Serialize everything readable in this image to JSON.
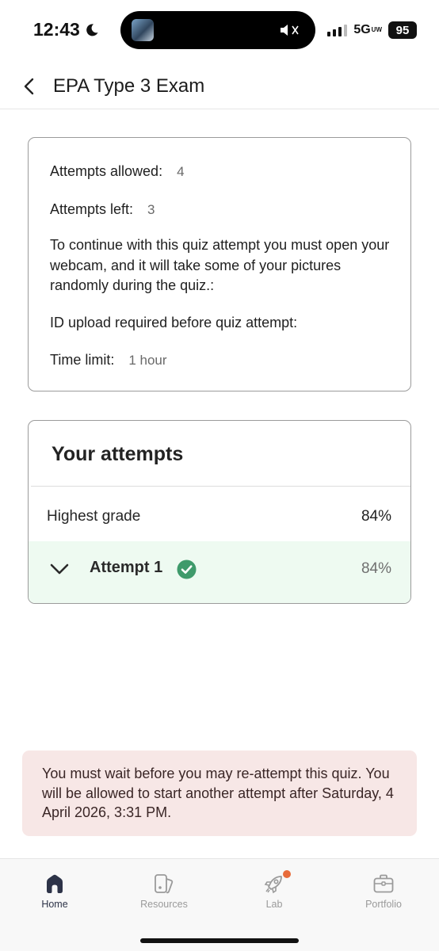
{
  "status_bar": {
    "time": "12:43",
    "network": "5G",
    "network_suffix": "UW",
    "battery": "95"
  },
  "header": {
    "title": "EPA Type 3 Exam"
  },
  "quiz_info": {
    "attempts_allowed_label": "Attempts allowed:",
    "attempts_allowed_value": "4",
    "attempts_left_label": "Attempts left:",
    "attempts_left_value": "3",
    "webcam_notice": "To continue with this quiz attempt you must open your webcam, and it will take some of your pictures randomly during the quiz.:",
    "id_upload_notice": "ID upload required before quiz attempt:",
    "time_limit_label": "Time limit:",
    "time_limit_value": "1 hour"
  },
  "attempts": {
    "title": "Your attempts",
    "highest_grade_label": "Highest grade",
    "highest_grade_value": "84%",
    "items": [
      {
        "label": "Attempt 1",
        "grade": "84%",
        "status_icon": "check-circle-icon",
        "status_color": "#3f9a6b"
      }
    ]
  },
  "notice": {
    "text": "You must wait before you may re-attempt this quiz. You will be allowed to start another attempt after Saturday, 4 April 2026, 3:31 PM."
  },
  "bottom_nav": {
    "items": [
      {
        "label": "Home",
        "icon": "home-icon",
        "active": true
      },
      {
        "label": "Resources",
        "icon": "resources-icon",
        "active": false
      },
      {
        "label": "Lab",
        "icon": "rocket-icon",
        "active": false,
        "badge_color": "#e86b3a"
      },
      {
        "label": "Portfolio",
        "icon": "briefcase-icon",
        "active": false
      }
    ]
  },
  "colors": {
    "attempt_row_bg": "#eefaf1",
    "notice_bg": "#f7e7e6",
    "nav_active": "#2d3348"
  }
}
